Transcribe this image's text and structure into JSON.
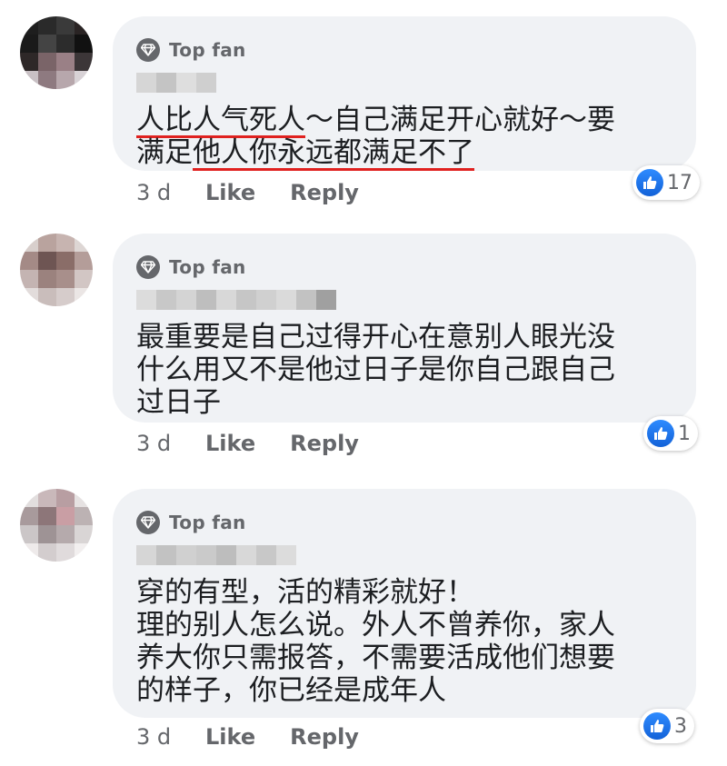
{
  "comments": [
    {
      "badge_label": "Top fan",
      "badge_icon": "diamond-icon",
      "text_parts": [
        "人比人气死人",
        "～自己满足开心就好～要\n满足",
        "他人你永远都满足不了",
        ""
      ],
      "time": "3 d",
      "like_label": "Like",
      "reply_label": "Reply",
      "reaction_count": "17"
    },
    {
      "badge_label": "Top fan",
      "badge_icon": "diamond-icon",
      "text": "最重要是自己过得开心在意别人眼光没\n什么用又不是他过日子是你自己跟自己\n过日子",
      "time": "3 d",
      "like_label": "Like",
      "reply_label": "Reply",
      "reaction_count": "1"
    },
    {
      "badge_label": "Top fan",
      "badge_icon": "diamond-icon",
      "text": "穿的有型，活的精彩就好！\n理的别人怎么说。外人不曾养你，家人\n养大你只需报答，不需要活成他们想要\n的样子，你已经是成年人",
      "time": "3 d",
      "like_label": "Like",
      "reply_label": "Reply",
      "reaction_count": "3"
    }
  ],
  "colors": {
    "bubble": "#f0f2f5",
    "secondary_text": "#65676b",
    "primary_text": "#1c1e21",
    "like_blue": "#1877f2",
    "underline_red": "#e0211f"
  }
}
